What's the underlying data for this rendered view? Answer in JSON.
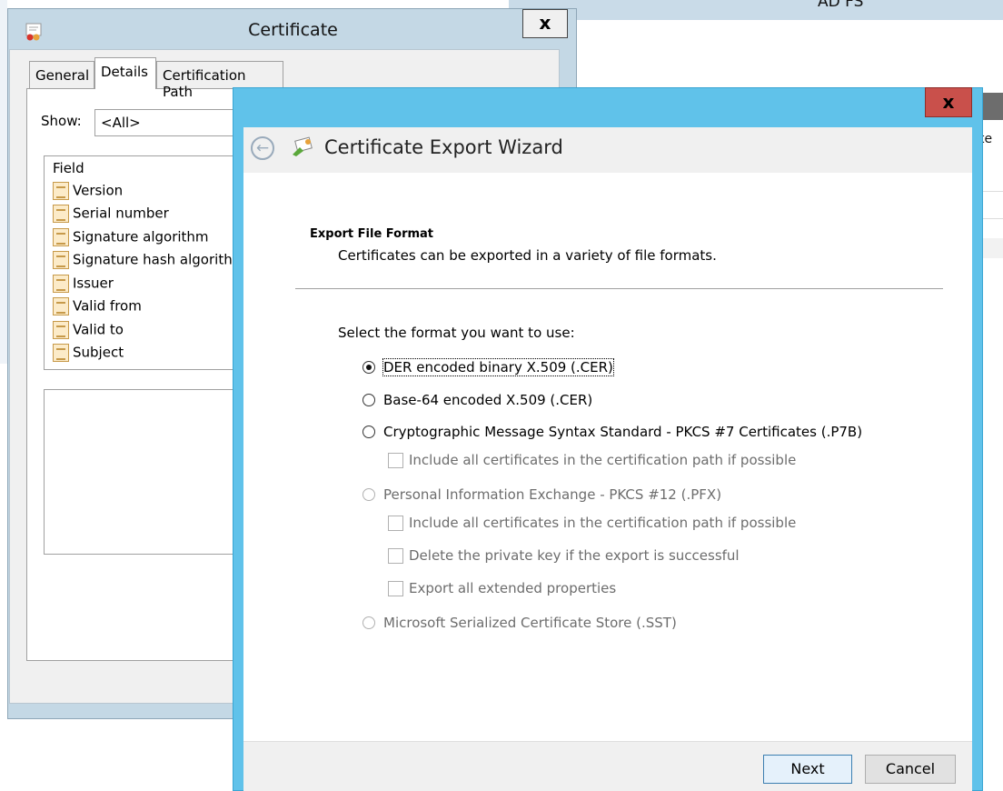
{
  "background_window": {
    "title": "AD FS",
    "column_fragment": "te"
  },
  "certificate_dialog": {
    "title": "Certificate",
    "close_glyph": "x",
    "tabs": [
      {
        "label": "General"
      },
      {
        "label": "Details",
        "selected": true
      },
      {
        "label": "Certification Path"
      }
    ],
    "show_label": "Show:",
    "show_value": "<All>",
    "field_header": "Field",
    "fields": [
      "Version",
      "Serial number",
      "Signature algorithm",
      "Signature hash algorithm",
      "Issuer",
      "Valid from",
      "Valid to",
      "Subject"
    ]
  },
  "wizard": {
    "title": "Certificate Export Wizard",
    "close_glyph": "x",
    "section_heading": "Export File Format",
    "section_description": "Certificates can be exported in a variety of file formats.",
    "prompt": "Select the format you want to use:",
    "options": [
      {
        "label": "DER encoded binary X.509 (.CER)",
        "checked": true,
        "enabled": true
      },
      {
        "label": "Base-64 encoded X.509 (.CER)",
        "checked": false,
        "enabled": true
      },
      {
        "label": "Cryptographic Message Syntax Standard - PKCS #7 Certificates (.P7B)",
        "checked": false,
        "enabled": true
      },
      {
        "label": "Personal Information Exchange - PKCS #12 (.PFX)",
        "checked": false,
        "enabled": false
      },
      {
        "label": "Microsoft Serialized Certificate Store (.SST)",
        "checked": false,
        "enabled": false
      }
    ],
    "p7b_sub": {
      "include_path": "Include all certificates in the certification path if possible"
    },
    "pfx_sub": {
      "include_path": "Include all certificates in the certification path if possible",
      "delete_key": "Delete the private key if the export is successful",
      "export_props": "Export all extended properties"
    },
    "buttons": {
      "next": "Next",
      "cancel": "Cancel"
    }
  }
}
